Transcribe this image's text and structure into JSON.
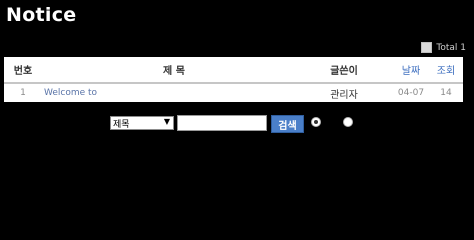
{
  "header": {
    "title": "Notice"
  },
  "total": {
    "label": "Total 1"
  },
  "table": {
    "columns": [
      "번호",
      "제 목",
      "글쓴이",
      "날짜",
      "조회"
    ],
    "rows": [
      {
        "num": "1",
        "subject": "Welcome to",
        "writer": "관리자",
        "date": "04-07",
        "hits": "14"
      }
    ]
  },
  "search": {
    "field": "제목",
    "query": "",
    "button_label": "검색",
    "selected_option_index": 0
  },
  "colors": {
    "accent": "#4a7fc9",
    "link": "#5a74a8",
    "header_blue": "#3b6dbf"
  }
}
